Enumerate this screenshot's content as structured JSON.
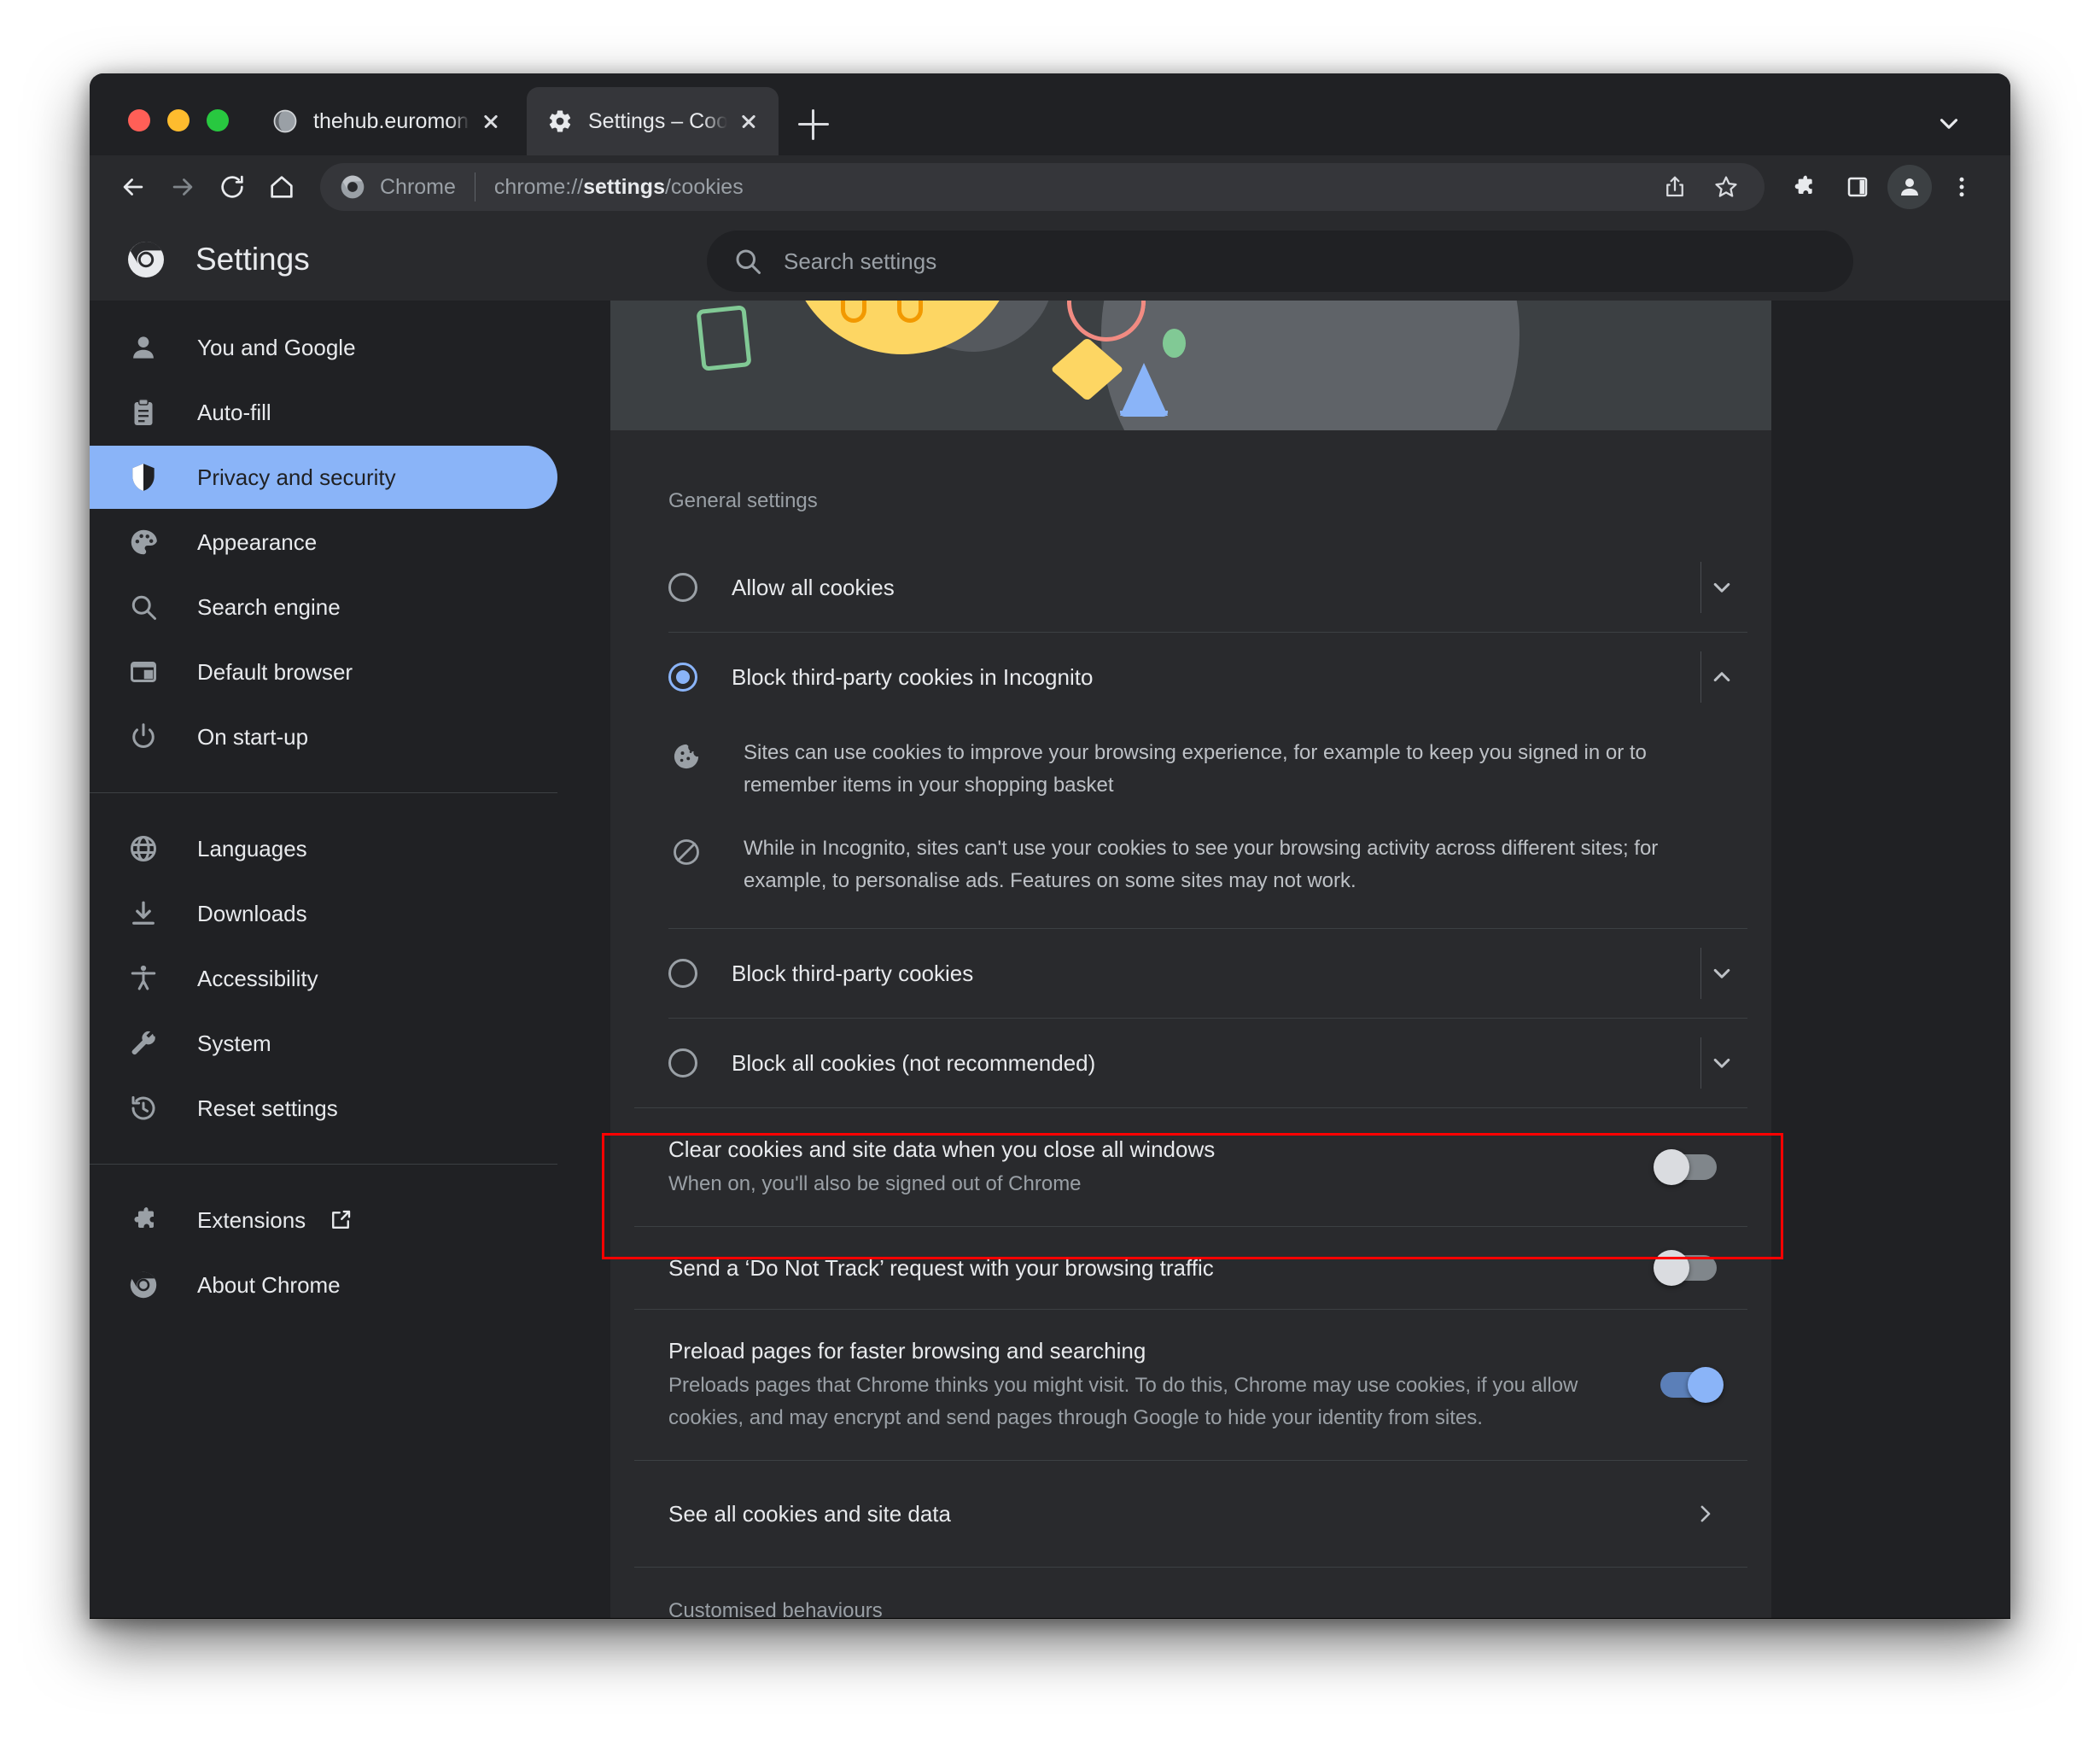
{
  "window": {
    "traffic_lights": [
      "close",
      "minimise",
      "maximise"
    ]
  },
  "tabs": [
    {
      "title": "thehub.euromoneyplc.com",
      "favicon": "globe-icon",
      "active": false
    },
    {
      "title": "Settings – Cookies and other si",
      "favicon": "gear-icon",
      "active": true
    }
  ],
  "tabstrip": {
    "new_tab_label": "+",
    "tab_list_chevron": "chevron-down-icon"
  },
  "toolbar": {
    "back": "back-arrow-icon",
    "forward": "forward-arrow-icon",
    "reload": "reload-icon",
    "home": "home-icon",
    "omnibox": {
      "page_icon": "chrome-icon",
      "scheme_label": "Chrome",
      "url_prefix": "chrome://",
      "url_bold": "settings",
      "url_suffix": "/cookies",
      "full_url": "chrome://settings/cookies"
    },
    "share": "share-icon",
    "bookmark": "star-icon",
    "extensions": "puzzle-icon",
    "side_panel": "side-panel-icon",
    "profile": "person-icon",
    "menu": "three-dot-menu-icon"
  },
  "settings_header": {
    "logo": "chrome-icon",
    "title": "Settings"
  },
  "search": {
    "icon": "search-icon",
    "placeholder": "Search settings",
    "value": ""
  },
  "sidebar": {
    "items": [
      {
        "label": "You and Google",
        "icon": "person-icon",
        "selected": false
      },
      {
        "label": "Auto-fill",
        "icon": "clipboard-icon",
        "selected": false
      },
      {
        "label": "Privacy and security",
        "icon": "shield-icon",
        "selected": true
      },
      {
        "label": "Appearance",
        "icon": "palette-icon",
        "selected": false
      },
      {
        "label": "Search engine",
        "icon": "search-icon",
        "selected": false
      },
      {
        "label": "Default browser",
        "icon": "browser-icon",
        "selected": false
      },
      {
        "label": "On start-up",
        "icon": "power-icon",
        "selected": false
      }
    ],
    "items2": [
      {
        "label": "Languages",
        "icon": "globe-icon",
        "selected": false
      },
      {
        "label": "Downloads",
        "icon": "download-icon",
        "selected": false
      },
      {
        "label": "Accessibility",
        "icon": "accessibility-icon",
        "selected": false
      },
      {
        "label": "System",
        "icon": "wrench-icon",
        "selected": false
      },
      {
        "label": "Reset settings",
        "icon": "history-icon",
        "selected": false
      }
    ],
    "items3": [
      {
        "label": "Extensions",
        "icon": "puzzle-icon",
        "external": "external-link-icon",
        "selected": false
      },
      {
        "label": "About Chrome",
        "icon": "chrome-icon",
        "selected": false
      }
    ]
  },
  "main": {
    "section_title": "General settings",
    "radio_options": [
      {
        "label": "Allow all cookies",
        "checked": false,
        "expanded": false,
        "chevron": "chevron-down-icon"
      },
      {
        "label": "Block third-party cookies in Incognito",
        "checked": true,
        "expanded": true,
        "chevron": "chevron-up-icon",
        "details": [
          {
            "icon": "cookie-icon",
            "text": "Sites can use cookies to improve your browsing experience, for example to keep you signed in or to remember items in your shopping basket"
          },
          {
            "icon": "block-icon",
            "text": "While in Incognito, sites can't use your cookies to see your browsing activity across different sites; for example, to personalise ads. Features on some sites may not work."
          }
        ]
      },
      {
        "label": "Block third-party cookies",
        "checked": false,
        "expanded": false,
        "chevron": "chevron-down-icon"
      },
      {
        "label": "Block all cookies (not recommended)",
        "checked": false,
        "expanded": false,
        "chevron": "chevron-down-icon"
      }
    ],
    "toggle_rows": [
      {
        "title": "Clear cookies and site data when you close all windows",
        "sub": "When on, you'll also be signed out of Chrome",
        "on": false,
        "highlighted": true
      },
      {
        "title": "Send a ‘Do Not Track’ request with your browsing traffic",
        "sub": "",
        "on": false,
        "highlighted": false
      },
      {
        "title": "Preload pages for faster browsing and searching",
        "sub": "Preloads pages that Chrome thinks you might visit. To do this, Chrome may use cookies, if you allow cookies, and may encrypt and send pages through Google to hide your identity from sites.",
        "on": true,
        "highlighted": false
      }
    ],
    "link_row": {
      "label": "See all cookies and site data",
      "arrow": "chevron-right-icon"
    },
    "next_section_title": "Customised behaviours"
  },
  "colors": {
    "accent_blue": "#8ab4f8",
    "window_bg": "#202124",
    "card_bg": "#292a2d",
    "toolbar_bg": "#292a2d",
    "banner_bg": "#3c4043",
    "text_primary": "#e8eaed",
    "text_secondary": "#9aa0a6",
    "annotation_red": "#ff0000",
    "illustration_yellow": "#fdd663",
    "illustration_green": "#81c995",
    "illustration_pink": "#f28b82",
    "illustration_orange": "#f29900"
  }
}
